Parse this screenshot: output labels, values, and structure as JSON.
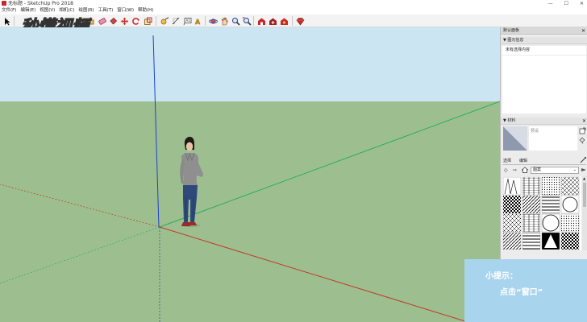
{
  "window": {
    "title": "无标题 - SketchUp Pro 2018",
    "minimize_label": "—",
    "maximize_label": "☐",
    "close_label": "✕"
  },
  "menu": [
    "文件(F)",
    "编辑(E)",
    "视图(V)",
    "相机(C)",
    "绘图(R)",
    "工具(T)",
    "窗口(W)",
    "帮助(H)"
  ],
  "watermark": {
    "text": "秒懂视频"
  },
  "toolbar": {
    "tools": [
      "select-icon",
      "eraser-icon",
      "line-icon",
      "arc-icon",
      "rectangle-icon",
      "push-pull-icon",
      "move-icon",
      "rotate-icon",
      "scale-icon",
      "tape-measure-icon",
      "text-icon",
      "paint-bucket-icon",
      "orbit-icon",
      "pan-icon",
      "zoom-icon",
      "zoom-extents-icon",
      "warehouse-icon",
      "extension-icon",
      "share-icon",
      "ruby-icon"
    ]
  },
  "tray": {
    "default_tray_label": "默认面板",
    "entity_info": {
      "header": "▼ 图元信息",
      "empty_text": "未有选择内容"
    },
    "materials": {
      "header": "▼ 材料",
      "preview_label": "预设",
      "tabs": [
        "选择",
        "编辑"
      ],
      "library_select": "图案",
      "colors": {
        "swatch_bg": "#c7ccd8",
        "swatch_fg": "#ffffff"
      }
    }
  },
  "hint": {
    "title": "小提示：",
    "body": "点击“窗口”"
  },
  "colors": {
    "sky": "#cbe6f2",
    "ground": "#9dbf8f",
    "axis_red": "#c0392b",
    "axis_green": "#27ae60",
    "axis_blue": "#1f3fcc",
    "hint_bg": "#a9d4ee"
  }
}
